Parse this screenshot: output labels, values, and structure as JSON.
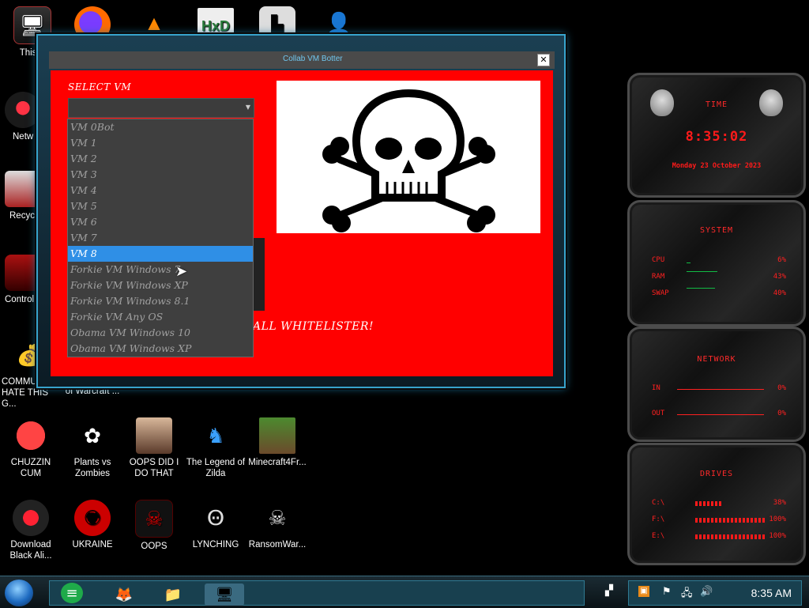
{
  "desktop": {
    "icons": [
      {
        "label": "This P",
        "icon": "computer-icon"
      },
      {
        "label": "",
        "icon": "firefox-icon"
      },
      {
        "label": "",
        "icon": "vlc-icon"
      },
      {
        "label": "",
        "icon": "hxd-icon"
      },
      {
        "label": "",
        "icon": "app-icon"
      },
      {
        "label": "",
        "icon": "user-icon"
      },
      {
        "label": "Netw",
        "icon": "network-icon"
      },
      {
        "label": "Recycle",
        "icon": "recycle-bin-icon"
      },
      {
        "label": "Control",
        "icon": "control-panel-icon"
      },
      {
        "label": "COMMU HATE THIS G...",
        "icon": "money-bag-icon"
      },
      {
        "label": "of Warcraft ...",
        "icon": "warcraft-icon"
      },
      {
        "label": "CHUZZIN CUM",
        "icon": "chuzzle-icon"
      },
      {
        "label": "Plants vs Zombies",
        "icon": "plants-vs-zombies-icon"
      },
      {
        "label": "OOPS DID I DO THAT",
        "icon": "portrait-icon"
      },
      {
        "label": "The Legend of Zilda",
        "icon": "zilda-icon"
      },
      {
        "label": "Minecraft4Fr...",
        "icon": "minecraft-icon"
      },
      {
        "label": "Download Black Ali...",
        "icon": "alien-icon"
      },
      {
        "label": "UKRAINE",
        "icon": "radiation-icon"
      },
      {
        "label": "OOPS",
        "icon": "oops-icon"
      },
      {
        "label": "LYNCHING",
        "icon": "rope-icon"
      },
      {
        "label": "RansomWar...",
        "icon": "skull-icon"
      }
    ]
  },
  "window": {
    "title": "Collab VM Botter",
    "close_label": "✕",
    "select_label": "SELECT VM",
    "select_value": "",
    "whitelist_text": "ALL WHITELISTER!",
    "dropdown_options": [
      "VM 0Bot",
      "VM 1",
      "VM 2",
      "VM 3",
      "VM 4",
      "VM 5",
      "VM 6",
      "VM 7",
      "VM 8",
      "Forkie VM Windows 7",
      "Forkie VM Windows XP",
      "Forkie VM Windows 8.1",
      "Forkie VM Any OS",
      "Obama VM Windows 10",
      "Obama VM Windows XP"
    ],
    "selected_option": "VM 8",
    "panel_icon": "skull-crossbones-icon"
  },
  "widgets": {
    "time": {
      "title": "TIME",
      "time": "8:35:02",
      "date": "Monday 23 October 2023"
    },
    "system": {
      "title": "SYSTEM",
      "rows": [
        {
          "label": "CPU",
          "value": "6%",
          "fraction": 0.06
        },
        {
          "label": "RAM",
          "value": "43%",
          "fraction": 0.43
        },
        {
          "label": "SWAP",
          "value": "40%",
          "fraction": 0.4
        }
      ]
    },
    "network": {
      "title": "NETWORK",
      "rows": [
        {
          "label": "IN",
          "value": "0%"
        },
        {
          "label": "OUT",
          "value": "0%"
        }
      ]
    },
    "drives": {
      "title": "DRIVES",
      "rows": [
        {
          "label": "C:\\",
          "value": "38%",
          "fraction": 0.38
        },
        {
          "label": "F:\\",
          "value": "100%",
          "fraction": 1.0
        },
        {
          "label": "E:\\",
          "value": "100%",
          "fraction": 1.0
        }
      ]
    }
  },
  "taskbar": {
    "clock": "8:35 AM",
    "pinned": [
      "notes-icon",
      "firefox-icon",
      "explorer-icon",
      "app-icon"
    ],
    "tray": [
      "app-tray-icon",
      "flag-icon",
      "network-tray-icon",
      "volume-icon"
    ]
  },
  "colors": {
    "accent": "#37a3cc",
    "client_bg": "#ff0000",
    "selected": "#2f8fe6",
    "widget_text": "#ff2020"
  }
}
